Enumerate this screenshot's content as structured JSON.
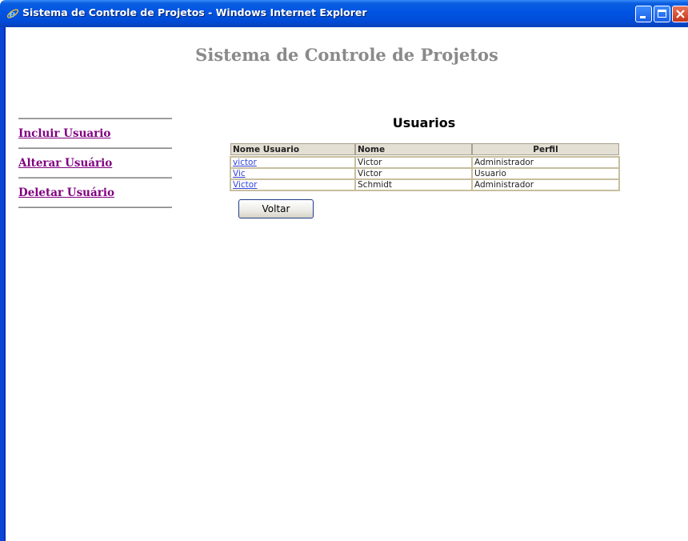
{
  "window": {
    "title": "Sistema de Controle de Projetos - Windows Internet Explorer",
    "accent_color": "#0054e3",
    "controls": [
      "minimize-icon",
      "maximize-icon",
      "close-icon"
    ]
  },
  "page": {
    "title": "Sistema de Controle de Projetos",
    "title_color": "#8a8a8a"
  },
  "nav": {
    "items": [
      {
        "label": "Incluir Usuario"
      },
      {
        "label": "Alterar Usuário"
      },
      {
        "label": "Deletar Usuário"
      }
    ],
    "link_color": "#800080"
  },
  "users": {
    "heading": "Usuarios",
    "columns": [
      "Nome Usuario",
      "Nome",
      "Perfil"
    ],
    "rows": [
      {
        "username": "victor",
        "name": "Victor",
        "profile": "Administrador"
      },
      {
        "username": "Vic",
        "name": "Victor",
        "profile": "Usuario"
      },
      {
        "username": "Victor",
        "name": "Schmidt",
        "profile": "Administrador"
      }
    ]
  },
  "actions": {
    "back_label": "Voltar"
  }
}
